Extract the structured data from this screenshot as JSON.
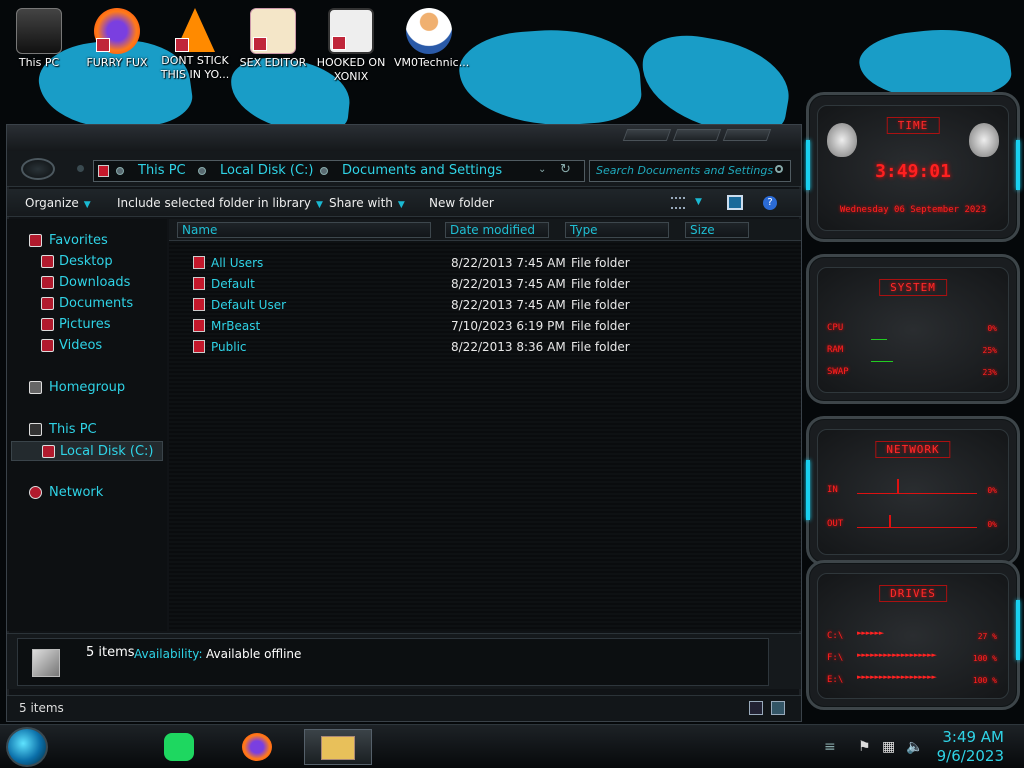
{
  "desktop": {
    "icons": [
      {
        "label": "This PC"
      },
      {
        "label": "FURRY FUX"
      },
      {
        "label": "DONT STICK THIS IN YO..."
      },
      {
        "label": "SEX EDITOR"
      },
      {
        "label": "HOOKED ON XONIX"
      },
      {
        "label": "VM0Technic..."
      }
    ]
  },
  "explorer": {
    "breadcrumb": [
      "This PC",
      "Local Disk (C:)",
      "Documents and Settings"
    ],
    "search_placeholder": "Search Documents and Settings",
    "toolbar": {
      "organize": "Organize",
      "include": "Include selected folder in library",
      "share": "Share with",
      "new_folder": "New folder"
    },
    "sidebar": {
      "favorites": "Favorites",
      "desktop": "Desktop",
      "downloads": "Downloads",
      "documents": "Documents",
      "pictures": "Pictures",
      "videos": "Videos",
      "homegroup": "Homegroup",
      "this_pc": "This PC",
      "local_disk": "Local Disk (C:)",
      "network": "Network"
    },
    "columns": {
      "name": "Name",
      "date": "Date modified",
      "type": "Type",
      "size": "Size"
    },
    "rows": [
      {
        "name": "All Users",
        "date": "8/22/2013 7:45 AM",
        "type": "File folder"
      },
      {
        "name": "Default",
        "date": "8/22/2013 7:45 AM",
        "type": "File folder"
      },
      {
        "name": "Default User",
        "date": "8/22/2013 7:45 AM",
        "type": "File folder"
      },
      {
        "name": "MrBeast",
        "date": "7/10/2023 6:19 PM",
        "type": "File folder"
      },
      {
        "name": "Public",
        "date": "8/22/2013 8:36 AM",
        "type": "File folder"
      }
    ],
    "details": {
      "count": "5 items",
      "availability_label": "Availability:",
      "availability_value": "Available offline"
    },
    "status": "5 items"
  },
  "gadgets": {
    "time": {
      "title": "TIME",
      "clock": "3:49:01",
      "date": "Wednesday 06 September 2023"
    },
    "system": {
      "title": "SYSTEM",
      "cpu_label": "CPU",
      "cpu_value": "0%",
      "ram_label": "RAM",
      "ram_value": "25%",
      "swap_label": "SWAP",
      "swap_value": "23%"
    },
    "network": {
      "title": "NETWORK",
      "in_label": "IN",
      "in_value": "0%",
      "out_label": "OUT",
      "out_value": "0%"
    },
    "drives": {
      "title": "DRIVES",
      "d1_label": "C:\\",
      "d1_value": "27 %",
      "d2_label": "F:\\",
      "d2_value": "100 %",
      "d3_label": "E:\\",
      "d3_value": "100 %"
    }
  },
  "taskbar": {
    "time": "3:49 AM",
    "date": "9/6/2023"
  },
  "colors": {
    "accent_cyan": "#2fd3e6",
    "gadget_red": "#ff2020"
  }
}
